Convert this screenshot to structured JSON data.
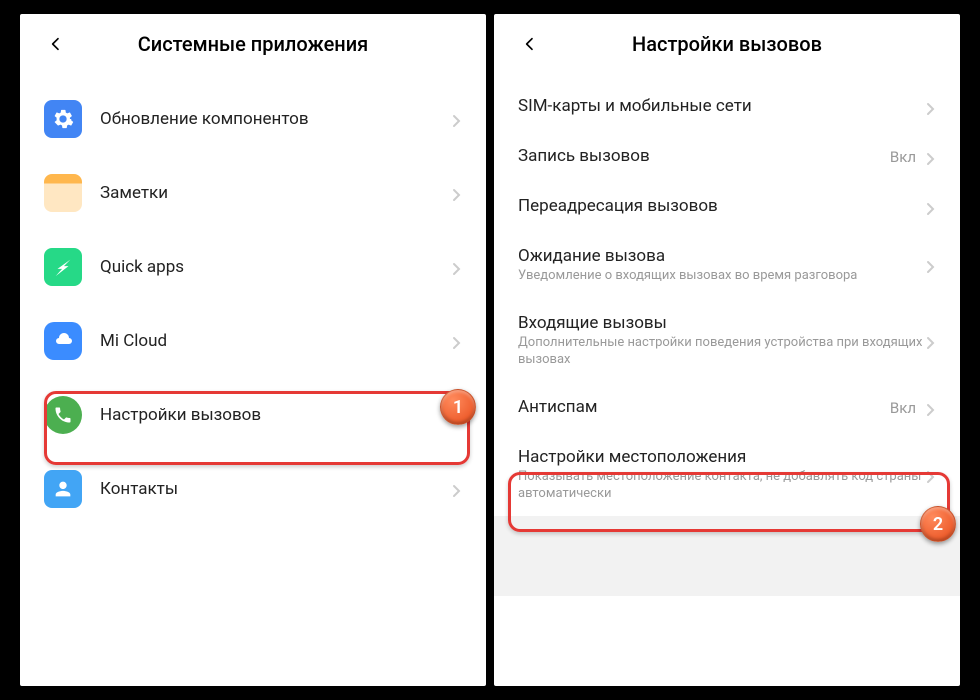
{
  "screen1": {
    "title": "Системные приложения",
    "items": [
      {
        "label": "Обновление компонентов",
        "icon": "gear"
      },
      {
        "label": "Заметки",
        "icon": "notes"
      },
      {
        "label": "Quick apps",
        "icon": "quickapps"
      },
      {
        "label": "Mi Cloud",
        "icon": "micloud"
      },
      {
        "label": "Настройки вызовов",
        "icon": "phone"
      },
      {
        "label": "Контакты",
        "icon": "contacts"
      }
    ],
    "badge": "1"
  },
  "screen2": {
    "title": "Настройки вызовов",
    "items": [
      {
        "title": "SIM-карты и мобильные сети"
      },
      {
        "title": "Запись вызовов",
        "value": "Вкл"
      },
      {
        "title": "Переадресация вызовов"
      },
      {
        "title": "Ожидание вызова",
        "subtitle": "Уведомление о входящих вызовах во время разговора"
      },
      {
        "title": "Входящие вызовы",
        "subtitle": "Дополнительные настройки поведения устройства при входящих вызовах"
      },
      {
        "title": "Антиспам",
        "value": "Вкл"
      },
      {
        "title": "Настройки местоположения",
        "subtitle": "Показывать местоположение контакта, не добавлять код страны автоматически"
      }
    ],
    "badge": "2"
  }
}
